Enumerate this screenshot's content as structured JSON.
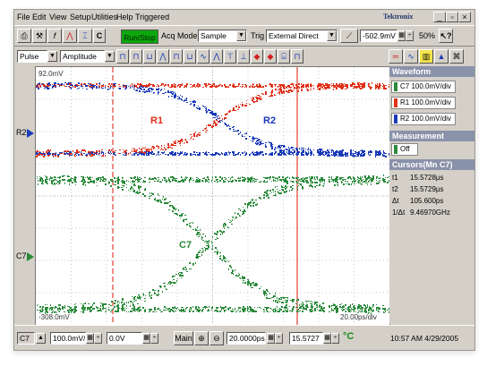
{
  "menu": {
    "items": [
      "File",
      "Edit",
      "View",
      "Setup",
      "Utilities",
      "Help"
    ],
    "status": "Triggered",
    "brand": "Tektronix"
  },
  "toolbar": {
    "c_label": "C",
    "run_stop": "Run/Stop",
    "acq_mode_label": "Acq Mode",
    "acq_mode_value": "Sample",
    "trig_label": "Trig",
    "trig_source": "External Direct",
    "trig_level": "-502.9mV",
    "zoom": "50%"
  },
  "meas_toolbar": {
    "meas_type": "Pulse",
    "meas_param": "Amplitude"
  },
  "display": {
    "top_label": "92.0mV",
    "bottom_label": "-308.0mV",
    "time_scale": "20.00ps/div",
    "waveform_labels": [
      "R1",
      "R2",
      "C7"
    ],
    "left_markers": [
      "R2",
      "C7"
    ]
  },
  "sidebar": {
    "waveform_header": "Waveform",
    "waveforms": [
      {
        "label": "C7 100.0mV/div",
        "color": "#2a8a3a"
      },
      {
        "label": "R1 100.0mV/div",
        "color": "#e03018"
      },
      {
        "label": "R2 100.0mV/div",
        "color": "#1a3ab8"
      }
    ],
    "measurement_header": "Measurement",
    "measurement_value": "Off",
    "cursors_header": "Cursors(Mn C7)",
    "cursors": [
      {
        "k": "t1",
        "v": "15.5728µs"
      },
      {
        "k": "t2",
        "v": "15.5729µs"
      },
      {
        "k": "Δt",
        "v": "105.600ps"
      },
      {
        "k": "1/Δt",
        "v": "9.46970GHz"
      }
    ]
  },
  "statusbar": {
    "channel": "C7",
    "scale": "100.0mV/",
    "offset": "0.0V",
    "timebase_mode": "Main",
    "horizontal_scale": "20.0000ps",
    "position": "15.5727",
    "time": "10:57 AM 4/29/2005"
  },
  "colors": {
    "r1": "#e03018",
    "r2": "#1a3ab8",
    "c7": "#2a8a3a",
    "cursor": "#e04030",
    "run_stop": "#0ca70c"
  }
}
